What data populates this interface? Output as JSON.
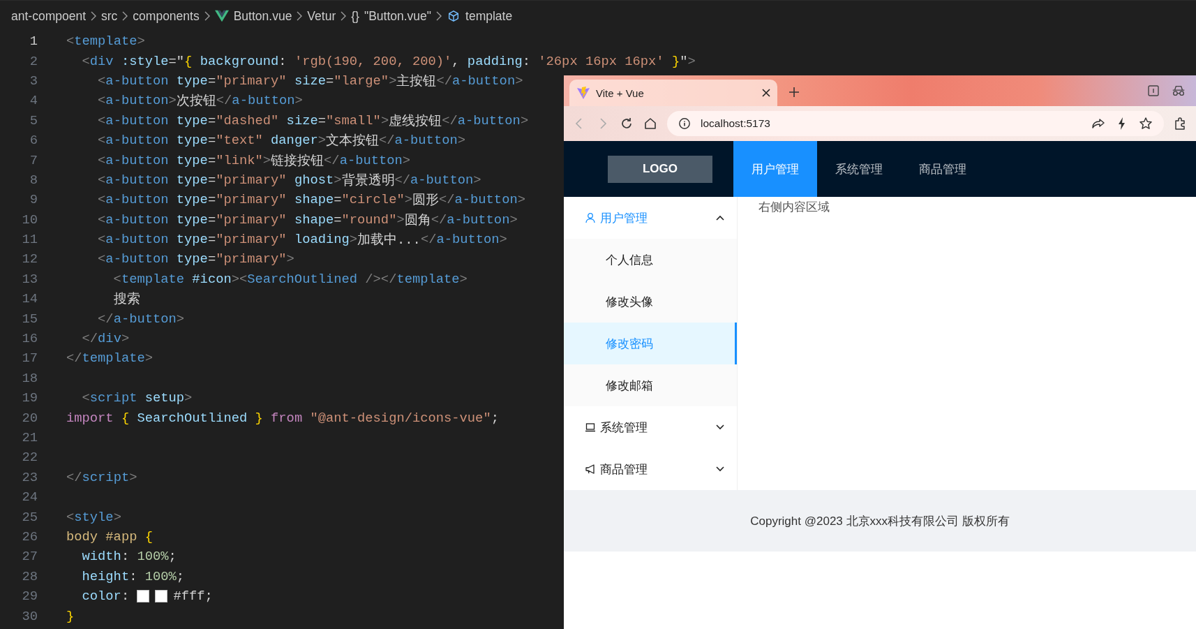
{
  "breadcrumb": [
    {
      "kind": "folder",
      "label": "ant-compoent"
    },
    {
      "kind": "folder",
      "label": "src"
    },
    {
      "kind": "folder",
      "label": "components"
    },
    {
      "kind": "vue",
      "label": "Button.vue"
    },
    {
      "kind": "folder",
      "label": "Vetur"
    },
    {
      "kind": "braces",
      "glyph": "{}",
      "label": "\"Button.vue\""
    },
    {
      "kind": "cube",
      "label": "template"
    }
  ],
  "code": {
    "lines": [
      {
        "number": "1",
        "selected": true,
        "tokens": [
          {
            "kind": "p",
            "text": "<"
          },
          {
            "kind": "tag",
            "text": "template"
          },
          {
            "kind": "p",
            "text": ">"
          }
        ]
      },
      {
        "number": "2",
        "selected": false,
        "tokens": [
          {
            "kind": "p",
            "text": "  <"
          },
          {
            "kind": "tag",
            "text": "div"
          },
          {
            "kind": "attr",
            "text": " :style"
          },
          {
            "kind": "txt",
            "text": "=\""
          },
          {
            "kind": "br",
            "text": "{"
          },
          {
            "kind": "attr",
            "text": " background"
          },
          {
            "kind": "txt",
            "text": ": "
          },
          {
            "kind": "str",
            "text": "'rgb(190, 200, 200)'"
          },
          {
            "kind": "txt",
            "text": ", "
          },
          {
            "kind": "attr",
            "text": "padding"
          },
          {
            "kind": "txt",
            "text": ": "
          },
          {
            "kind": "str",
            "text": "'26px 16px 16px'"
          },
          {
            "kind": "br",
            "text": " }"
          },
          {
            "kind": "txt",
            "text": "\""
          },
          {
            "kind": "p",
            "text": ">"
          }
        ]
      },
      {
        "number": "3",
        "selected": false,
        "tokens": [
          {
            "kind": "p",
            "text": "    <"
          },
          {
            "kind": "tag",
            "text": "a-button"
          },
          {
            "kind": "attr",
            "text": " type"
          },
          {
            "kind": "txt",
            "text": "="
          },
          {
            "kind": "str",
            "text": "\"primary\""
          },
          {
            "kind": "attr",
            "text": " size"
          },
          {
            "kind": "txt",
            "text": "="
          },
          {
            "kind": "str",
            "text": "\"large\""
          },
          {
            "kind": "p",
            "text": ">"
          },
          {
            "kind": "txt",
            "text": "主按钮"
          },
          {
            "kind": "p",
            "text": "</"
          },
          {
            "kind": "tag",
            "text": "a-button"
          },
          {
            "kind": "p",
            "text": ">"
          }
        ]
      },
      {
        "number": "4",
        "selected": false,
        "tokens": [
          {
            "kind": "p",
            "text": "    <"
          },
          {
            "kind": "tag",
            "text": "a-button"
          },
          {
            "kind": "p",
            "text": ">"
          },
          {
            "kind": "txt",
            "text": "次按钮"
          },
          {
            "kind": "p",
            "text": "</"
          },
          {
            "kind": "tag",
            "text": "a-button"
          },
          {
            "kind": "p",
            "text": ">"
          }
        ]
      },
      {
        "number": "5",
        "selected": false,
        "tokens": [
          {
            "kind": "p",
            "text": "    <"
          },
          {
            "kind": "tag",
            "text": "a-button"
          },
          {
            "kind": "attr",
            "text": " type"
          },
          {
            "kind": "txt",
            "text": "="
          },
          {
            "kind": "str",
            "text": "\"dashed\""
          },
          {
            "kind": "attr",
            "text": " size"
          },
          {
            "kind": "txt",
            "text": "="
          },
          {
            "kind": "str",
            "text": "\"small\""
          },
          {
            "kind": "p",
            "text": ">"
          },
          {
            "kind": "txt",
            "text": "虚线按钮"
          },
          {
            "kind": "p",
            "text": "</"
          },
          {
            "kind": "tag",
            "text": "a-button"
          },
          {
            "kind": "p",
            "text": ">"
          }
        ]
      },
      {
        "number": "6",
        "selected": false,
        "tokens": [
          {
            "kind": "p",
            "text": "    <"
          },
          {
            "kind": "tag",
            "text": "a-button"
          },
          {
            "kind": "attr",
            "text": " type"
          },
          {
            "kind": "txt",
            "text": "="
          },
          {
            "kind": "str",
            "text": "\"text\""
          },
          {
            "kind": "attr",
            "text": " danger"
          },
          {
            "kind": "p",
            "text": ">"
          },
          {
            "kind": "txt",
            "text": "文本按钮"
          },
          {
            "kind": "p",
            "text": "</"
          },
          {
            "kind": "tag",
            "text": "a-button"
          },
          {
            "kind": "p",
            "text": ">"
          }
        ]
      },
      {
        "number": "7",
        "selected": false,
        "tokens": [
          {
            "kind": "p",
            "text": "    <"
          },
          {
            "kind": "tag",
            "text": "a-button"
          },
          {
            "kind": "attr",
            "text": " type"
          },
          {
            "kind": "txt",
            "text": "="
          },
          {
            "kind": "str",
            "text": "\"link\""
          },
          {
            "kind": "p",
            "text": ">"
          },
          {
            "kind": "txt",
            "text": "链接按钮"
          },
          {
            "kind": "p",
            "text": "</"
          },
          {
            "kind": "tag",
            "text": "a-button"
          },
          {
            "kind": "p",
            "text": ">"
          }
        ]
      },
      {
        "number": "8",
        "selected": false,
        "tokens": [
          {
            "kind": "p",
            "text": "    <"
          },
          {
            "kind": "tag",
            "text": "a-button"
          },
          {
            "kind": "attr",
            "text": " type"
          },
          {
            "kind": "txt",
            "text": "="
          },
          {
            "kind": "str",
            "text": "\"primary\""
          },
          {
            "kind": "attr",
            "text": " ghost"
          },
          {
            "kind": "p",
            "text": ">"
          },
          {
            "kind": "txt",
            "text": "背景透明"
          },
          {
            "kind": "p",
            "text": "</"
          },
          {
            "kind": "tag",
            "text": "a-button"
          },
          {
            "kind": "p",
            "text": ">"
          }
        ]
      },
      {
        "number": "9",
        "selected": false,
        "tokens": [
          {
            "kind": "p",
            "text": "    <"
          },
          {
            "kind": "tag",
            "text": "a-button"
          },
          {
            "kind": "attr",
            "text": " type"
          },
          {
            "kind": "txt",
            "text": "="
          },
          {
            "kind": "str",
            "text": "\"primary\""
          },
          {
            "kind": "attr",
            "text": " shape"
          },
          {
            "kind": "txt",
            "text": "="
          },
          {
            "kind": "str",
            "text": "\"circle\""
          },
          {
            "kind": "p",
            "text": ">"
          },
          {
            "kind": "txt",
            "text": "圆形"
          },
          {
            "kind": "p",
            "text": "</"
          },
          {
            "kind": "tag",
            "text": "a-button"
          },
          {
            "kind": "p",
            "text": ">"
          }
        ]
      },
      {
        "number": "10",
        "selected": false,
        "tokens": [
          {
            "kind": "p",
            "text": "    <"
          },
          {
            "kind": "tag",
            "text": "a-button"
          },
          {
            "kind": "attr",
            "text": " type"
          },
          {
            "kind": "txt",
            "text": "="
          },
          {
            "kind": "str",
            "text": "\"primary\""
          },
          {
            "kind": "attr",
            "text": " shape"
          },
          {
            "kind": "txt",
            "text": "="
          },
          {
            "kind": "str",
            "text": "\"round\""
          },
          {
            "kind": "p",
            "text": ">"
          },
          {
            "kind": "txt",
            "text": "圆角"
          },
          {
            "kind": "p",
            "text": "</"
          },
          {
            "kind": "tag",
            "text": "a-button"
          },
          {
            "kind": "p",
            "text": ">"
          }
        ]
      },
      {
        "number": "11",
        "selected": false,
        "tokens": [
          {
            "kind": "p",
            "text": "    <"
          },
          {
            "kind": "tag",
            "text": "a-button"
          },
          {
            "kind": "attr",
            "text": " type"
          },
          {
            "kind": "txt",
            "text": "="
          },
          {
            "kind": "str",
            "text": "\"primary\""
          },
          {
            "kind": "attr",
            "text": " loading"
          },
          {
            "kind": "p",
            "text": ">"
          },
          {
            "kind": "txt",
            "text": "加载中..."
          },
          {
            "kind": "p",
            "text": "</"
          },
          {
            "kind": "tag",
            "text": "a-button"
          },
          {
            "kind": "p",
            "text": ">"
          }
        ]
      },
      {
        "number": "12",
        "selected": false,
        "tokens": [
          {
            "kind": "p",
            "text": "    <"
          },
          {
            "kind": "tag",
            "text": "a-button"
          },
          {
            "kind": "attr",
            "text": " type"
          },
          {
            "kind": "txt",
            "text": "="
          },
          {
            "kind": "str",
            "text": "\"primary\""
          },
          {
            "kind": "p",
            "text": ">"
          }
        ]
      },
      {
        "number": "13",
        "selected": false,
        "tokens": [
          {
            "kind": "p",
            "text": "      <"
          },
          {
            "kind": "tag",
            "text": "template"
          },
          {
            "kind": "attr",
            "text": " #icon"
          },
          {
            "kind": "p",
            "text": "><"
          },
          {
            "kind": "tag",
            "text": "SearchOutlined"
          },
          {
            "kind": "p",
            "text": " /></"
          },
          {
            "kind": "tag",
            "text": "template"
          },
          {
            "kind": "p",
            "text": ">"
          }
        ]
      },
      {
        "number": "14",
        "selected": false,
        "tokens": [
          {
            "kind": "txt",
            "text": "      搜索"
          }
        ]
      },
      {
        "number": "15",
        "selected": false,
        "tokens": [
          {
            "kind": "p",
            "text": "    </"
          },
          {
            "kind": "tag",
            "text": "a-button"
          },
          {
            "kind": "p",
            "text": ">"
          }
        ]
      },
      {
        "number": "16",
        "selected": false,
        "tokens": [
          {
            "kind": "p",
            "text": "  </"
          },
          {
            "kind": "tag",
            "text": "div"
          },
          {
            "kind": "p",
            "text": ">"
          }
        ]
      },
      {
        "number": "17",
        "selected": false,
        "tokens": [
          {
            "kind": "p",
            "text": "</"
          },
          {
            "kind": "tag",
            "text": "template"
          },
          {
            "kind": "p",
            "text": ">"
          }
        ]
      },
      {
        "number": "18",
        "selected": false
      },
      {
        "number": "19",
        "selected": false,
        "tokens": [
          {
            "kind": "p",
            "text": "  <"
          },
          {
            "kind": "tag",
            "text": "script"
          },
          {
            "kind": "attr",
            "text": " setup"
          },
          {
            "kind": "p",
            "text": ">"
          }
        ]
      },
      {
        "number": "20",
        "selected": false,
        "tokens": [
          {
            "kind": "kw",
            "text": "import "
          },
          {
            "kind": "br",
            "text": "{"
          },
          {
            "kind": "attr",
            "text": " SearchOutlined "
          },
          {
            "kind": "br",
            "text": "}"
          },
          {
            "kind": "kw",
            "text": " from "
          },
          {
            "kind": "str",
            "text": "\"@ant-design/icons-vue\""
          },
          {
            "kind": "txt",
            "text": ";"
          }
        ]
      },
      {
        "number": "21",
        "selected": false
      },
      {
        "number": "22",
        "selected": false
      },
      {
        "number": "23",
        "selected": false,
        "tokens": [
          {
            "kind": "p",
            "text": "</"
          },
          {
            "kind": "tag",
            "text": "script"
          },
          {
            "kind": "p",
            "text": ">"
          }
        ]
      },
      {
        "number": "24",
        "selected": false
      },
      {
        "number": "25",
        "selected": false,
        "tokens": [
          {
            "kind": "p",
            "text": "<"
          },
          {
            "kind": "tag",
            "text": "style"
          },
          {
            "kind": "p",
            "text": ">"
          }
        ]
      },
      {
        "number": "26",
        "selected": false,
        "tokens": [
          {
            "kind": "sel",
            "text": "body #app "
          },
          {
            "kind": "br",
            "text": "{"
          }
        ]
      },
      {
        "number": "27",
        "selected": false,
        "tokens": [
          {
            "kind": "attr",
            "text": "  width"
          },
          {
            "kind": "txt",
            "text": ": "
          },
          {
            "kind": "num",
            "text": "100%"
          },
          {
            "kind": "txt",
            "text": ";"
          }
        ]
      },
      {
        "number": "28",
        "selected": false,
        "tokens": [
          {
            "kind": "attr",
            "text": "  height"
          },
          {
            "kind": "txt",
            "text": ": "
          },
          {
            "kind": "num",
            "text": "100%"
          },
          {
            "kind": "txt",
            "text": ";"
          }
        ]
      },
      {
        "number": "29",
        "selected": false,
        "tokens": [
          {
            "kind": "attr",
            "text": "  color"
          },
          {
            "kind": "txt",
            "text": ": "
          },
          {
            "kind": "swatch",
            "color": "#ffffff"
          },
          {
            "kind": "swatch",
            "color": "#ffffff"
          },
          {
            "kind": "txt",
            "text": "#fff;"
          }
        ]
      },
      {
        "number": "30",
        "selected": false,
        "tokens": [
          {
            "kind": "br",
            "text": "}"
          }
        ]
      }
    ]
  },
  "browser": {
    "tab": {
      "title": "Vite + Vue"
    },
    "address": "localhost:5173",
    "app": {
      "logo": "LOGO",
      "nav": [
        {
          "label": "用户管理",
          "selected": true
        },
        {
          "label": "系统管理",
          "selected": false
        },
        {
          "label": "商品管理",
          "selected": false
        }
      ],
      "sidebar": [
        {
          "label": "用户管理",
          "selected": true,
          "expanded": true,
          "children": [
            {
              "label": "个人信息",
              "selected": false
            },
            {
              "label": "修改头像",
              "selected": false
            },
            {
              "label": "修改密码",
              "selected": true
            },
            {
              "label": "修改邮箱",
              "selected": false
            }
          ]
        },
        {
          "label": "系统管理",
          "selected": false,
          "expanded": false
        },
        {
          "label": "商品管理",
          "selected": false,
          "expanded": false
        }
      ],
      "content": "右侧内容区域",
      "footer": "Copyright @2023 北京xxx科技有限公司 版权所有"
    }
  }
}
